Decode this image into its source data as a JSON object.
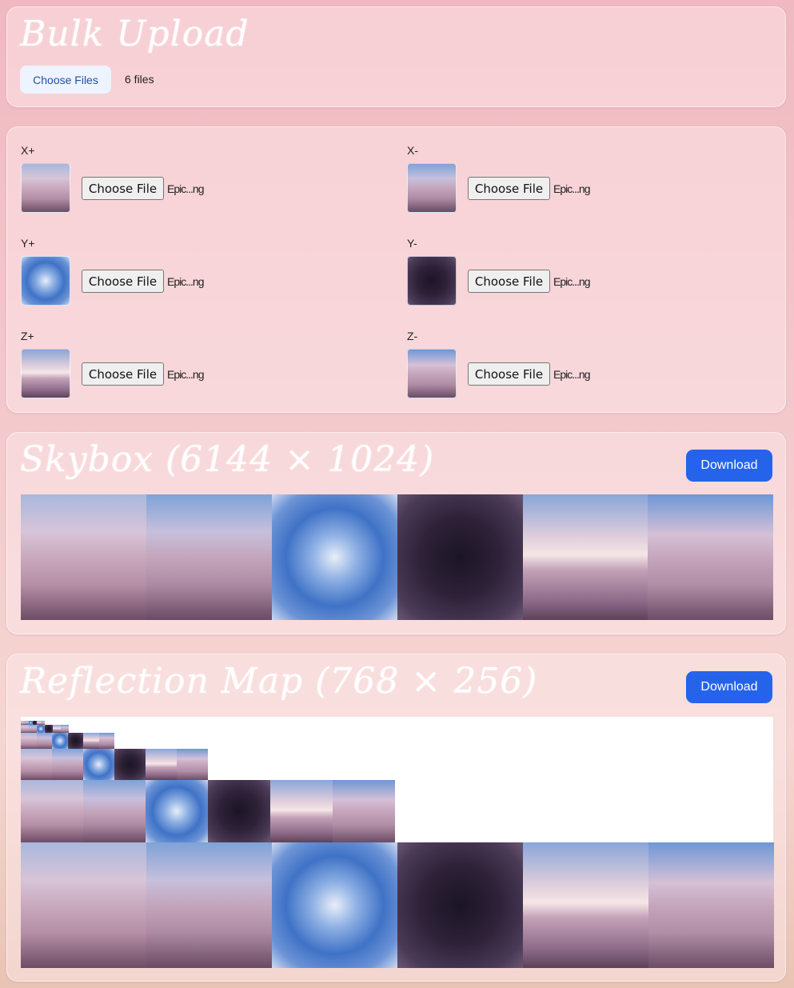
{
  "bulk_upload": {
    "title": "Bulk Upload",
    "choose_files_label": "Choose Files",
    "files_status": "6 files"
  },
  "faces": [
    {
      "label": "X+",
      "button": "Choose File",
      "file_name": "Epic...ng",
      "sky": "sky-a"
    },
    {
      "label": "X-",
      "button": "Choose File",
      "file_name": "Epic...ng",
      "sky": "sky-b"
    },
    {
      "label": "Y+",
      "button": "Choose File",
      "file_name": "Epic...ng",
      "sky": "sky-up"
    },
    {
      "label": "Y-",
      "button": "Choose File",
      "file_name": "Epic...ng",
      "sky": "sky-down"
    },
    {
      "label": "Z+",
      "button": "Choose File",
      "file_name": "Epic...ng",
      "sky": "sky-c"
    },
    {
      "label": "Z-",
      "button": "Choose File",
      "file_name": "Epic...ng",
      "sky": "sky-d"
    }
  ],
  "skybox": {
    "title": "Skybox (6144 × 1024)",
    "download_label": "Download"
  },
  "reflection": {
    "title": "Reflection Map (768 × 256)",
    "download_label": "Download"
  },
  "skybox_order": [
    "sky-a",
    "sky-b",
    "sky-up",
    "sky-down",
    "sky-c",
    "sky-d"
  ],
  "colors": {
    "accent": "#2563eb",
    "card_bg": "rgba(255,235,238,0.45)",
    "choose_files_bg": "#eef4ff"
  }
}
